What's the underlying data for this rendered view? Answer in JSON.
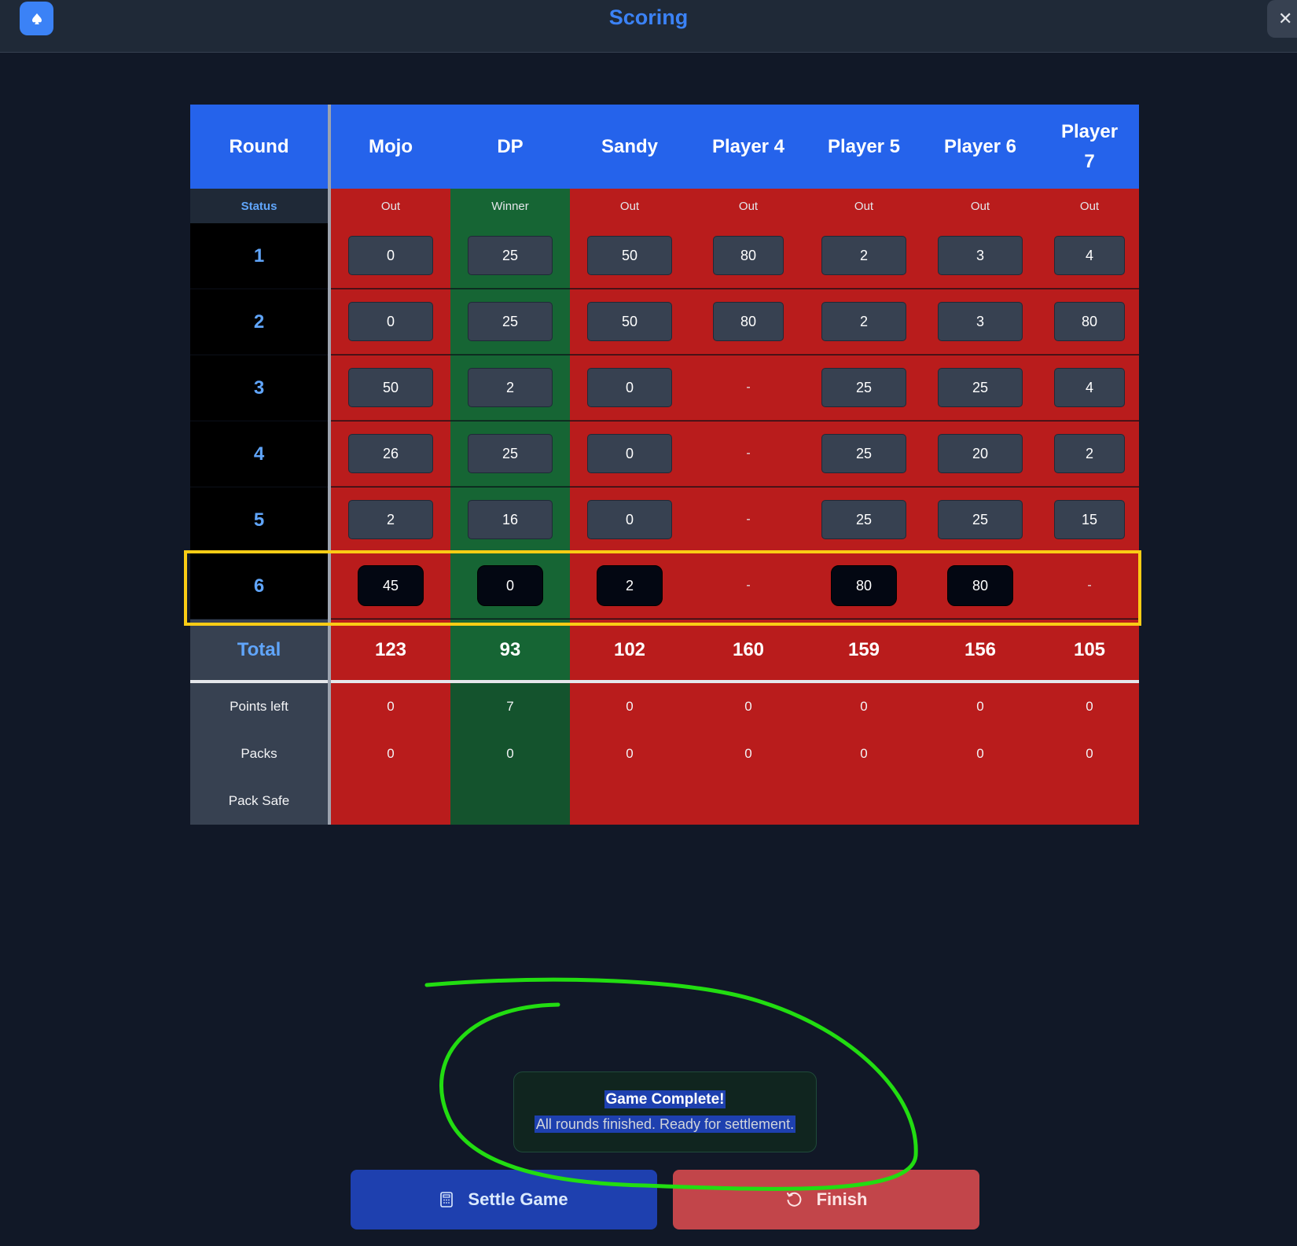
{
  "header": {
    "title": "Scoring",
    "close_label": "✕"
  },
  "table": {
    "round_label": "Round",
    "status_label": "Status",
    "total_label": "Total",
    "points_left_label": "Points left",
    "packs_label": "Packs",
    "pack_safe_label": "Pack Safe",
    "players": [
      {
        "name": "Mojo",
        "status": "Out",
        "scores": [
          "0",
          "0",
          "50",
          "26",
          "2",
          "45"
        ],
        "total": "123",
        "points_left": "0",
        "packs": "0"
      },
      {
        "name": "DP",
        "status": "Winner",
        "scores": [
          "25",
          "25",
          "2",
          "25",
          "16",
          "0"
        ],
        "total": "93",
        "points_left": "7",
        "packs": "0"
      },
      {
        "name": "Sandy",
        "status": "Out",
        "scores": [
          "50",
          "50",
          "0",
          "0",
          "0",
          "2"
        ],
        "total": "102",
        "points_left": "0",
        "packs": "0"
      },
      {
        "name": "Player 4",
        "status": "Out",
        "scores": [
          "80",
          "80",
          "-",
          "-",
          "-",
          "-"
        ],
        "total": "160",
        "points_left": "0",
        "packs": "0"
      },
      {
        "name": "Player 5",
        "status": "Out",
        "scores": [
          "2",
          "2",
          "25",
          "25",
          "25",
          "80"
        ],
        "total": "159",
        "points_left": "0",
        "packs": "0"
      },
      {
        "name": "Player 6",
        "status": "Out",
        "scores": [
          "3",
          "3",
          "25",
          "20",
          "25",
          "80"
        ],
        "total": "156",
        "points_left": "0",
        "packs": "0"
      },
      {
        "name": "Player 7",
        "status": "Out",
        "scores": [
          "4",
          "80",
          "4",
          "2",
          "15",
          "-"
        ],
        "total": "105",
        "points_left": "0",
        "packs": "0"
      }
    ],
    "rounds": [
      "1",
      "2",
      "3",
      "4",
      "5",
      "6"
    ],
    "current_round": "6"
  },
  "notice": {
    "title": "Game Complete!",
    "text": "All rounds finished. Ready for settlement."
  },
  "buttons": {
    "settle": "Settle Game",
    "finish": "Finish"
  },
  "colors": {
    "accent": "#2563eb",
    "out": "#b91c1c",
    "winner": "#166534",
    "highlight": "#facc15",
    "annotation": "#22dd11"
  }
}
